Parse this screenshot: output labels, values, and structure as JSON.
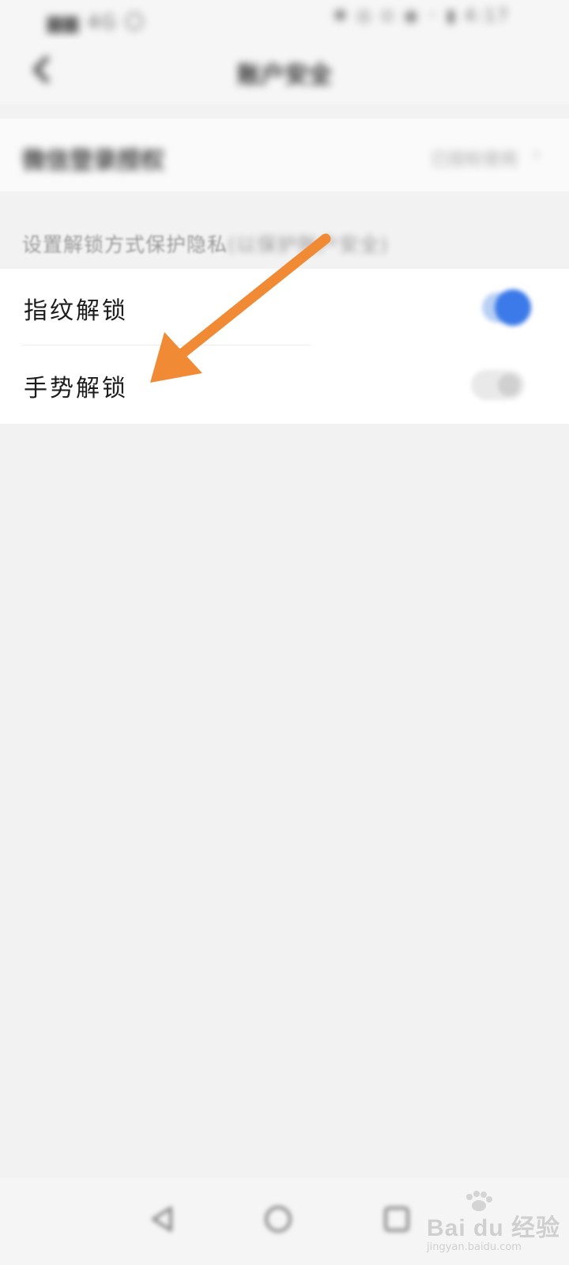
{
  "status_bar": {
    "left_text": "▆▆ 4G 〇",
    "right_text": "✱ ◎ ⊙ ◉ ◦ ▮ 4:17"
  },
  "header": {
    "title": "账户安全",
    "back_icon": "back-arrow-icon"
  },
  "top_item": {
    "label": "微信登录授权",
    "value": "已授权使用",
    "chevron_icon": "chevron-right-icon"
  },
  "section_hint": {
    "text_clear": "设置解锁方式保护隐私",
    "text_blurred": "(以保护账户安全)"
  },
  "unlock_options": [
    {
      "label": "指纹解锁",
      "enabled": true
    },
    {
      "label": "手势解锁",
      "enabled": false
    }
  ],
  "annotation": {
    "color": "#f08a34",
    "icon": "pointer-arrow-icon"
  },
  "nav_bar": {
    "icons": [
      "nav-back-icon",
      "nav-home-icon",
      "nav-recent-icon"
    ]
  },
  "watermark": {
    "brand": "Bai du 经验",
    "sub": "jingyan.baidu.com"
  }
}
